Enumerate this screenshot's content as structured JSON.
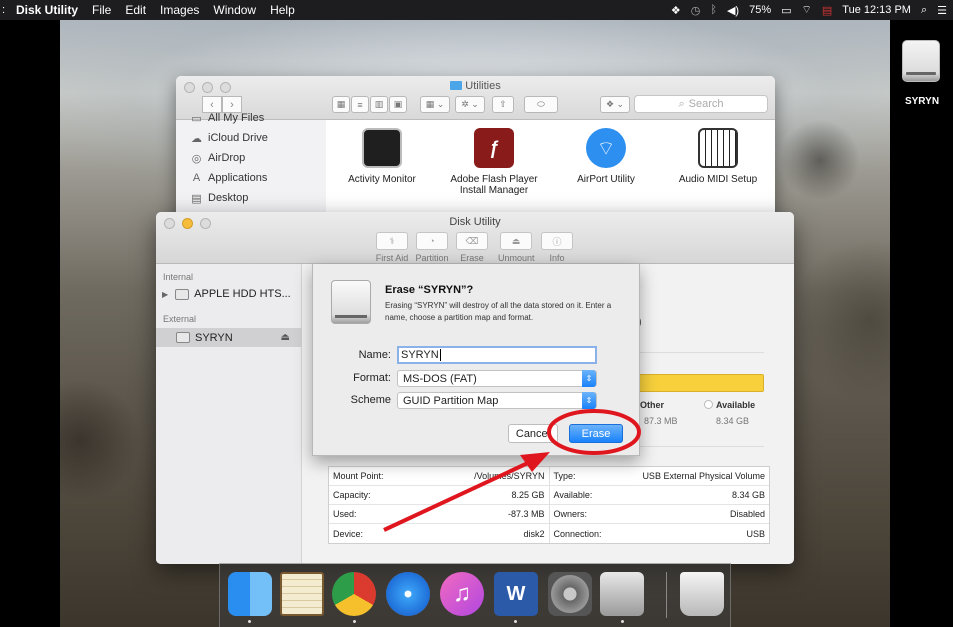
{
  "menubar": {
    "app_name": "Disk Utility",
    "menus": [
      "File",
      "Edit",
      "Images",
      "Window",
      "Help"
    ],
    "battery": "75%",
    "clock": "Tue 12:13 PM"
  },
  "desktop": {
    "drive_label": "SYRYN"
  },
  "finder": {
    "title": "Utilities",
    "search_placeholder": "Search",
    "sidebar": [
      {
        "label": "All My Files",
        "icon": "all-files-icon"
      },
      {
        "label": "iCloud Drive",
        "icon": "cloud-icon"
      },
      {
        "label": "AirDrop",
        "icon": "airdrop-icon"
      },
      {
        "label": "Applications",
        "icon": "applications-icon"
      },
      {
        "label": "Desktop",
        "icon": "desktop-icon"
      }
    ],
    "apps": [
      {
        "label": "Activity Monitor",
        "color": "#1f1f1f"
      },
      {
        "label": "Adobe Flash Player Install Manager",
        "color": "#8a1b1b"
      },
      {
        "label": "AirPort Utility",
        "color": "#2d8ff0"
      },
      {
        "label": "Audio MIDI Setup",
        "color": "#2a2a2a"
      }
    ]
  },
  "disk_utility": {
    "title": "Disk Utility",
    "toolbar": [
      "First Aid",
      "Partition",
      "Erase",
      "Unmount",
      "Info"
    ],
    "sidebar": {
      "internal_header": "Internal",
      "internal_device": "APPLE HDD HTS...",
      "external_header": "External",
      "external_device": "SYRYN"
    },
    "partial_paren": ")",
    "legend": {
      "other_label": "Other",
      "other_value": "87.3 MB",
      "available_label": "Available",
      "available_value": "8.34 GB"
    },
    "info": [
      {
        "k1": "Mount Point:",
        "v1": "/Volumes/SYRYN",
        "k2": "Type:",
        "v2": "USB External Physical Volume"
      },
      {
        "k1": "Capacity:",
        "v1": "8.25 GB",
        "k2": "Available:",
        "v2": "8.34 GB"
      },
      {
        "k1": "Used:",
        "v1": "-87.3 MB",
        "k2": "Owners:",
        "v2": "Disabled"
      },
      {
        "k1": "Device:",
        "v1": "disk2",
        "k2": "Connection:",
        "v2": "USB"
      }
    ]
  },
  "erase_sheet": {
    "title": "Erase “SYRYN”?",
    "message": "Erasing “SYRYN” will destroy of all the data stored on it. Enter a name, choose a partition map and format.",
    "name_label": "Name:",
    "name_value": "SYRYN",
    "format_label": "Format:",
    "format_value": "MS-DOS (FAT)",
    "scheme_label": "Scheme",
    "scheme_value": "GUID Partition Map",
    "cancel_label": "Cancel",
    "erase_label": "Erase"
  },
  "colors": {
    "accent": "#1a82fb",
    "usage_bar": "#f7d03c",
    "annotation": "#e0161f"
  }
}
